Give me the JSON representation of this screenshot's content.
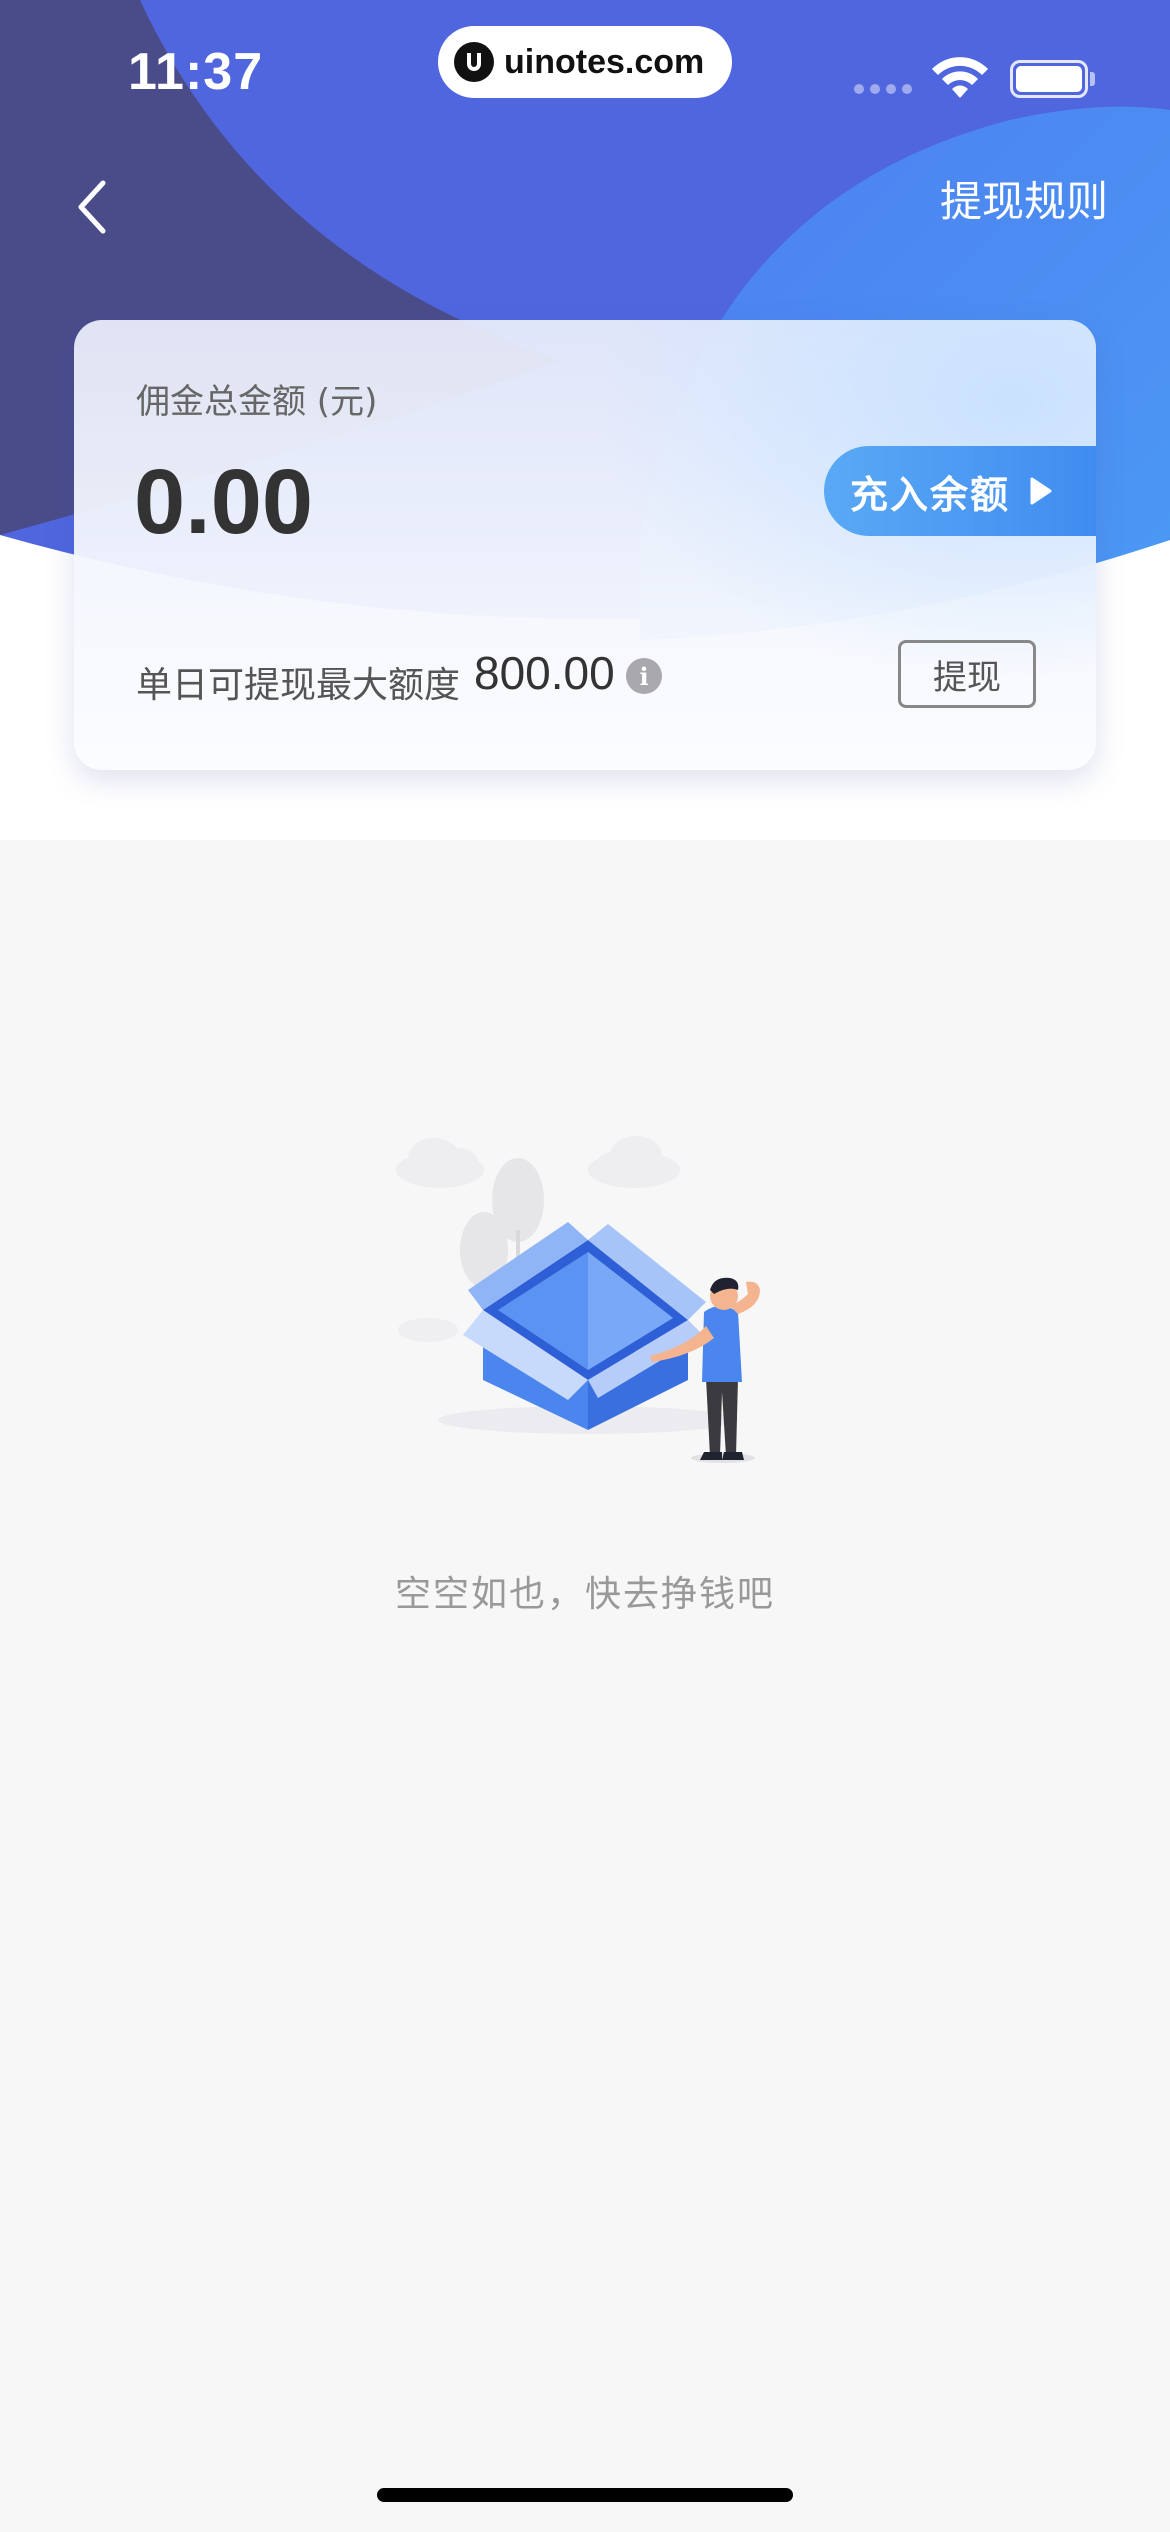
{
  "status_bar": {
    "time": "11:37",
    "url": "uinotes.com"
  },
  "nav": {
    "back_icon": "chevron-left-icon",
    "rules_label": "提现规则"
  },
  "card": {
    "total_label": "佣金总金额 (元)",
    "total_amount": "0.00",
    "recharge_label": "充入余额",
    "limit_label": "单日可提现最大额度",
    "limit_value": "800.00",
    "info_icon": "info-icon",
    "withdraw_label": "提现"
  },
  "empty_state": {
    "illustration": "empty-box-illustration",
    "message": "空空如也，快去挣钱吧"
  },
  "colors": {
    "header_dark": "#4a4d8e",
    "header_mid": "#4f68e0",
    "header_light": "#4a8cf0",
    "recharge_button": "#4a9af2",
    "page_bg": "#f7f7f8"
  }
}
